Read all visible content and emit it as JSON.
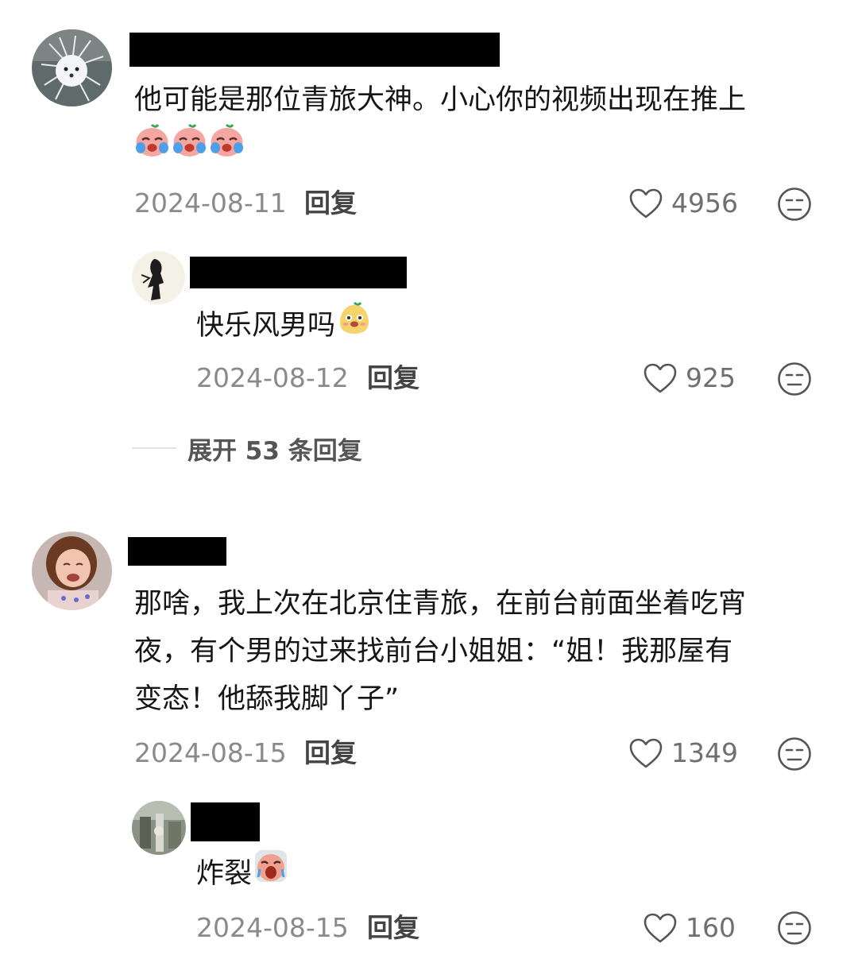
{
  "comments": [
    {
      "text_lines": [
        "他可能是那位青旅大神。小心你的视频出现在推上"
      ],
      "emojis": [
        "crying-face-emoji",
        "crying-face-emoji",
        "crying-face-emoji"
      ],
      "date": "2024-08-11",
      "reply_label": "回复",
      "likes": "4956",
      "replies": [
        {
          "text": "快乐风男吗",
          "emoji": "smirk-face-emoji",
          "date": "2024-08-12",
          "reply_label": "回复",
          "likes": "925"
        }
      ],
      "expand_label": "展开 53 条回复"
    },
    {
      "text_lines": [
        "那啥，我上次在北京住青旅，在前台前面坐着吃宵",
        "夜，有个男的过来找前台小姐姐：“姐！我那屋有",
        "变态！他舔我脚丫子”"
      ],
      "date": "2024-08-15",
      "reply_label": "回复",
      "likes": "1349",
      "replies": [
        {
          "text": "炸裂",
          "emoji": "wailing-face-emoji",
          "date": "2024-08-15",
          "reply_label": "回复",
          "likes": "160"
        }
      ]
    }
  ],
  "colors": {
    "text": "#161616",
    "meta": "#8a8a8a",
    "icon": "#555555",
    "redaction": "#000000"
  }
}
